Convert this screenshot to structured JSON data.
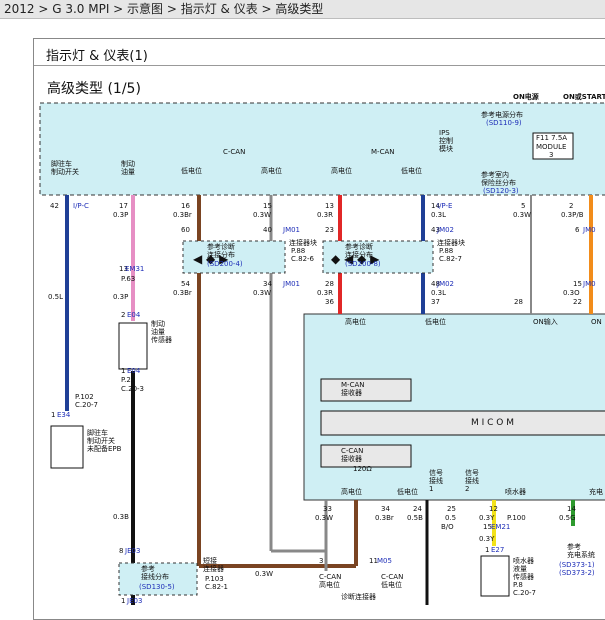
{
  "breadcrumb": "2012 > G 3.0 MPI > 示意图 > 指示灯 & 仪表 > 高级类型",
  "panel_title": "指示灯 & 仪表(1)",
  "diagram_title": "高级类型 (1/5)",
  "colors": {
    "box_fill": "#cfeff4",
    "blue": "#1f3f96",
    "pink": "#e68fc4",
    "brown": "#7a4422",
    "red": "#e12727",
    "orange": "#f28c1a",
    "yellow": "#f2e21a",
    "green": "#2e9a2e",
    "link": "#1f2fb8"
  },
  "labels": {
    "on_power": "ON电源",
    "on_or_start": "ON或START",
    "ref_power_dist": "参考电源分布",
    "sd110_9": "(SD110-9)",
    "ips_control": [
      "IPS",
      "控制",
      "模块"
    ],
    "fuse_f11": "F11 7.5A",
    "module": "MODULE",
    "module_no": "3",
    "ref_ground_dist": [
      "参考室内",
      "保险丝分布"
    ],
    "sd120_3": "(SD120-3)",
    "parking_brake_switch_top": [
      "脚驻车",
      "制动开关"
    ],
    "brake_fluid_top": [
      "制动",
      "油量"
    ],
    "c_can": "C-CAN",
    "m_can": "M-CAN",
    "low_level": "低电位",
    "high_level": "高电位",
    "pin_42": "42",
    "ipc": "I/P-C",
    "pin_17": "17",
    "pin_16": "16",
    "pin_15": "15",
    "pin_13": "13",
    "pin_14": "14",
    "pin_5": "5",
    "pin_2": "2",
    "w03p": "0.3P",
    "w03br": "0.3Br",
    "w03w": "0.3W",
    "w03r": "0.3R",
    "w03l": "0.3L",
    "w03pb": "0.3P/B",
    "pin_60": "60",
    "pin_40": "40",
    "pin_23": "23",
    "pin_43": "43",
    "pin_6": "6",
    "jm01": "JM01",
    "jm02": "JM02",
    "jm0": "JM0",
    "ipe": "I/P-E",
    "ref_diag_dist": [
      "参考诊断",
      "连接分布"
    ],
    "sd200_4": "(SD200-4)",
    "sd200_8": "(SD200-8)",
    "conn_block": "连接器块",
    "p88": "P.88",
    "c82_6": "C.82-6",
    "c82_7": "C.82-7",
    "pin_54": "54",
    "pin_34": "34",
    "pin_28": "28",
    "pin_48": "48",
    "pin_36": "36",
    "pin_37": "37",
    "pin_15b": "15",
    "pin_22": "22",
    "w03o": "0.3O",
    "em31": "EM31",
    "p63": "P.63",
    "e04": "E04",
    "w05l": "0.5L",
    "brake_fluid_sensor": [
      "制动",
      "油量",
      "传感器"
    ],
    "p21": "P.21",
    "c20_3": "C.20-3",
    "p102": "P.102",
    "c20_7": "C.20-7",
    "e34": "E34",
    "parking_brake_switch": [
      "脚驻车",
      "制动开关"
    ],
    "no_epb": "未配备EPB",
    "on_input": "ON输入",
    "on": "ON",
    "m_can_rx": [
      "M-CAN",
      "接收器"
    ],
    "micom": "M I C O M",
    "c_can_rx": [
      "C-CAN",
      "接收器"
    ],
    "r120": "120Ω",
    "signal1": [
      "信号",
      "接线",
      "1"
    ],
    "signal2": [
      "信号",
      "接线",
      "2"
    ],
    "washer": "喷水器",
    "charge": "充电",
    "pin_33": "33",
    "pin_34b": "34",
    "pin_24": "24",
    "pin_25": "25",
    "pin_12": "12",
    "pin_14b": "14",
    "w03bbr": "0.3Br",
    "w05b": "0.5B",
    "w05bo": "0.5",
    "bo": "B/O",
    "w03y": "0.3Y",
    "w05g": "0.5G",
    "p100": "P.100",
    "em21": "EM21",
    "pin_15c": "15",
    "w03b": "0.3B",
    "w03y2": "0.3Y",
    "e27": "E27",
    "washer_sensor": [
      "喷水器",
      "液量",
      "传感器"
    ],
    "p8": "P.8",
    "c20_7b": "C.20-7",
    "ref_charge": [
      "参考",
      "充电系统"
    ],
    "sd373_1": "(SD373-1)",
    "sd373_2": "(SD373-2)",
    "je03": "JE03",
    "pin_8": "8",
    "ref_ground2": [
      "参考",
      "接线分布"
    ],
    "sd130_5": "(SD130-5)",
    "short_conn": [
      "短接",
      "连接器"
    ],
    "p103": "P.103",
    "c82_1": "C.82-1",
    "pin_3": "3",
    "pin_11": "11",
    "m05": "M05",
    "c_can_high": [
      "C-CAN",
      "高电位"
    ],
    "c_can_low": [
      "C-CAN",
      "低电位"
    ],
    "diag_conn": "诊断连接器",
    "w03w2": "0.3W",
    "pin_1": "1"
  }
}
